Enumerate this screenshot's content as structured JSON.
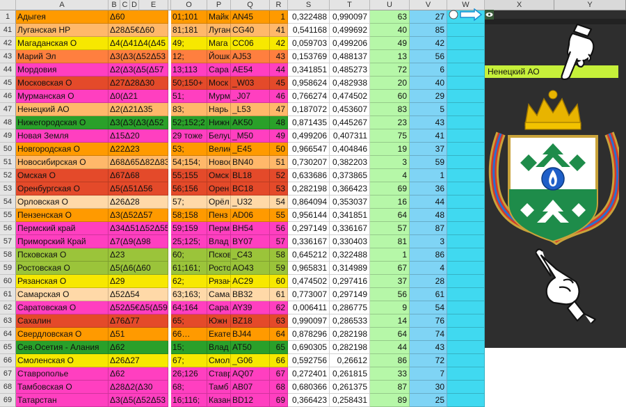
{
  "columns": {
    "a": "A",
    "b": "B",
    "c": "C",
    "d": "D",
    "e": "E",
    "o": "O",
    "p": "P",
    "q": "Q",
    "r": "R",
    "s": "S",
    "t": "T",
    "u": "U",
    "v": "V",
    "w": "W",
    "x": "X",
    "y": "Y"
  },
  "rows": [
    {
      "n": "1",
      "region": "Адыгея",
      "code": "Δ60",
      "reg": "01;101",
      "city": "Майк",
      "plate": "AN45",
      "idx": "1",
      "s": "0,322488",
      "t": "0,990097",
      "u": "63",
      "v": "27",
      "color": "#ff9a00"
    },
    {
      "n": "41",
      "region": "Луганская НР",
      "code": "Δ28Δ5€Δ60",
      "reg": "81;181",
      "city": "Луган",
      "plate": "CG40",
      "idx": "41",
      "s": "0,541168",
      "t": "0,499692",
      "u": "40",
      "v": "85",
      "color": "#ffb86a"
    },
    {
      "n": "42",
      "region": "Магаданская О",
      "code": "Δ4(Δ41Δ4(Δ45",
      "reg": "49;",
      "city": "Мага",
      "plate": "CC06",
      "idx": "42",
      "s": "0,059703",
      "t": "0,499206",
      "u": "49",
      "v": "42",
      "color": "#f7e800"
    },
    {
      "n": "43",
      "region": "Марий Эл",
      "code": "Δ3(Δ3(Δ52Δ53",
      "reg": "12;",
      "city": "Йошк",
      "plate": "AJ53",
      "idx": "43",
      "s": "0,153769",
      "t": "0,488137",
      "u": "13",
      "v": "56",
      "color": "#ff7f3f"
    },
    {
      "n": "44",
      "region": "Мордовия",
      "code": "Δ2(Δ3(Δ5(Δ57",
      "reg": "13;113",
      "city": "Сара",
      "plate": "AE54",
      "idx": "44",
      "s": "0,341851",
      "t": "0,485273",
      "u": "72",
      "v": "6",
      "color": "#ff3fc0"
    },
    {
      "n": "45",
      "region": "Московская О",
      "code": "Δ27Δ28Δ30",
      "reg": "50;150+",
      "city": "Моск",
      "plate": "_W03",
      "idx": "45",
      "s": "0,958624",
      "t": "0,482938",
      "u": "20",
      "v": "40",
      "color": "#e44a2a"
    },
    {
      "n": "46",
      "region": "Мурманская О",
      "code": "Δ0(Δ21",
      "reg": "51;",
      "city": "Мурм",
      "plate": "_J07",
      "idx": "46",
      "s": "0,766274",
      "t": "0,474502",
      "u": "60",
      "v": "29",
      "color": "#ff3fc0"
    },
    {
      "n": "47",
      "region": "Ненецкий АО",
      "code": "Δ2(Δ21Δ35",
      "reg": "83;",
      "city": "Нарь",
      "plate": "_L53",
      "idx": "47",
      "s": "0,187072",
      "t": "0,453607",
      "u": "83",
      "v": "5",
      "color": "#ffb86a"
    },
    {
      "n": "48",
      "region": "Нижегородская О",
      "code": "Δ3(Δ3(Δ3(Δ52",
      "reg": "52;152;2",
      "city": "Нижн",
      "plate": "AK50",
      "idx": "48",
      "s": "0,871435",
      "t": "0,445267",
      "u": "23",
      "v": "43",
      "color": "#2aa02a"
    },
    {
      "n": "49",
      "region": "Новая Земля",
      "code": "Δ15Δ20",
      "reg": "29 тоже",
      "city": "Белуш",
      "plate": "_M50",
      "idx": "49",
      "s": "0,499206",
      "t": "0,407311",
      "u": "75",
      "v": "41",
      "color": "#ff3fc0"
    },
    {
      "n": "50",
      "region": "Новгородская О",
      "code": "Δ22Δ23",
      "reg": "53;",
      "city": "Велик",
      "plate": "_E45",
      "idx": "50",
      "s": "0,966547",
      "t": "0,404846",
      "u": "19",
      "v": "37",
      "color": "#ff9a00"
    },
    {
      "n": "51",
      "region": "Новосибирская О",
      "code": "Δ68Δ65Δ82Δ83",
      "reg": "54;154;",
      "city": "Новос",
      "plate": "BN40",
      "idx": "51",
      "s": "0,730207",
      "t": "0,382203",
      "u": "3",
      "v": "59",
      "color": "#ffb86a"
    },
    {
      "n": "52",
      "region": "Омская О",
      "code": "Δ67Δ68",
      "reg": "55;155",
      "city": "Омск",
      "plate": "BL18",
      "idx": "52",
      "s": "0,633686",
      "t": "0,373865",
      "u": "4",
      "v": "1",
      "color": "#e44a2a"
    },
    {
      "n": "53",
      "region": "Оренбургская О",
      "code": "Δ5(Δ51Δ56",
      "reg": "56;156",
      "city": "Орен",
      "plate": "BC18",
      "idx": "53",
      "s": "0,282198",
      "t": "0,366423",
      "u": "69",
      "v": "36",
      "color": "#e44a2a"
    },
    {
      "n": "54",
      "region": "Орловская О",
      "code": "Δ26Δ28",
      "reg": "57;",
      "city": "Орёл",
      "plate": "_U32",
      "idx": "54",
      "s": "0,864094",
      "t": "0,353037",
      "u": "16",
      "v": "44",
      "color": "#ffd9a8"
    },
    {
      "n": "55",
      "region": "Пензенская О",
      "code": "Δ3(Δ52Δ57",
      "reg": "58;158",
      "city": "Пенз",
      "plate": "AD06",
      "idx": "55",
      "s": "0,956144",
      "t": "0,341851",
      "u": "64",
      "v": "48",
      "color": "#ff9a00"
    },
    {
      "n": "56",
      "region": "Пермский край",
      "code": "Δ34Δ51Δ52Δ55",
      "reg": "59;159",
      "city": "Перм",
      "plate": "BH54",
      "idx": "56",
      "s": "0,297149",
      "t": "0,336167",
      "u": "57",
      "v": "87",
      "color": "#ff3fc0"
    },
    {
      "n": "57",
      "region": "Приморский Край",
      "code": "Δ7(Δ9(Δ98",
      "reg": "25;125;",
      "city": "Влад",
      "plate": "BY07",
      "idx": "57",
      "s": "0,336167",
      "t": "0,330403",
      "u": "81",
      "v": "3",
      "color": "#ff3fc0"
    },
    {
      "n": "58",
      "region": "Псковская О",
      "code": "Δ23",
      "reg": "60;",
      "city": "Псков",
      "plate": "_C43",
      "idx": "58",
      "s": "0,645212",
      "t": "0,322488",
      "u": "1",
      "v": "86",
      "color": "#9bc43a"
    },
    {
      "n": "59",
      "region": "Ростовская О",
      "code": "Δ5(Δ6(Δ60",
      "reg": "61;161;",
      "city": "Росто",
      "plate": "AO43",
      "idx": "59",
      "s": "0,965831",
      "t": "0,314989",
      "u": "67",
      "v": "4",
      "color": "#9bc43a"
    },
    {
      "n": "60",
      "region": "Рязанская О",
      "code": "Δ29",
      "reg": "62;",
      "city": "Рязан",
      "plate": "AC29",
      "idx": "60",
      "s": "0,474502",
      "t": "0,297416",
      "u": "37",
      "v": "28",
      "color": "#f7e800"
    },
    {
      "n": "61",
      "region": "Самарская О",
      "code": "Δ52Δ54",
      "reg": "63;163;",
      "city": "Сама",
      "plate": "BB32",
      "idx": "61",
      "s": "0,773007",
      "t": "0,297149",
      "u": "56",
      "v": "61",
      "color": "#ffd9a8"
    },
    {
      "n": "62",
      "region": "Саратовская О",
      "code": "Δ52Δ5€Δ5(Δ59",
      "reg": "64;164",
      "city": "Сара",
      "plate": "AY39",
      "idx": "62",
      "s": "0,006411",
      "t": "0,286775",
      "u": "9",
      "v": "54",
      "color": "#ff3fc0"
    },
    {
      "n": "63",
      "region": "Сахалин",
      "code": "Δ76Δ77",
      "reg": "65;",
      "city": "Южн",
      "plate": "BZ18",
      "idx": "63",
      "s": "0,990097",
      "t": "0,286533",
      "u": "14",
      "v": "76",
      "color": "#e44a2a"
    },
    {
      "n": "64",
      "region": "Свердловская О",
      "code": "Δ51",
      "reg": "66…",
      "city": "Екате",
      "plate": "BJ44",
      "idx": "64",
      "s": "0,878296",
      "t": "0,282198",
      "u": "64",
      "v": "74",
      "color": "#ff9a00"
    },
    {
      "n": "65",
      "region": "Сев.Осетия - Алания",
      "code": "Δ62",
      "reg": "15;",
      "city": "Влад",
      "plate": "AT50",
      "idx": "65",
      "s": "0,690305",
      "t": "0,282198",
      "u": "44",
      "v": "43",
      "color": "#2aa02a"
    },
    {
      "n": "66",
      "region": "Смоленская О",
      "code": "Δ26Δ27",
      "reg": "67;",
      "city": "Смол",
      "plate": "_G06",
      "idx": "66",
      "s": "0,592756",
      "t": "0,26612",
      "u": "86",
      "v": "72",
      "color": "#f7e800"
    },
    {
      "n": "67",
      "region": "Ставрополье",
      "code": "Δ62",
      "reg": "26;126",
      "city": "Ставр",
      "plate": "AQ07",
      "idx": "67",
      "s": "0,272401",
      "t": "0,261815",
      "u": "33",
      "v": "7",
      "color": "#ff3fc0"
    },
    {
      "n": "68",
      "region": "Тамбовская О",
      "code": "Δ28Δ2(Δ30",
      "reg": "68;",
      "city": "Тамб",
      "plate": "AB07",
      "idx": "68",
      "s": "0,680366",
      "t": "0,261375",
      "u": "87",
      "v": "30",
      "color": "#ff3fc0"
    },
    {
      "n": "69",
      "region": "Татарстан",
      "code": "Δ3(Δ5(Δ52Δ53",
      "reg": "16;116;",
      "city": "Казан",
      "plate": "BD12",
      "idx": "69",
      "s": "0,366423",
      "t": "0,258431",
      "u": "89",
      "v": "25",
      "color": "#ff3fc0"
    }
  ],
  "panel": {
    "selected_region": "Ненецкий АО",
    "eye_icon": "eye-icon",
    "arrow_icon": "arrow-right-icon",
    "circle_icon": "circle-button-icon",
    "pointer_top_icon": "glove-pointer-down-icon",
    "pointer_bottom_icon": "glove-pointer-up-icon",
    "emblem_icon": "nenets-emblem-icon"
  },
  "colors": {
    "s_col": "#ffffff",
    "t_col": "#ffffff",
    "u_col": "#b6f7a8",
    "v_col": "#7fd4f5",
    "w_col": "#40d9f0",
    "panel_bg": "#2e2e2e",
    "label_bg": "#c6f03a"
  }
}
